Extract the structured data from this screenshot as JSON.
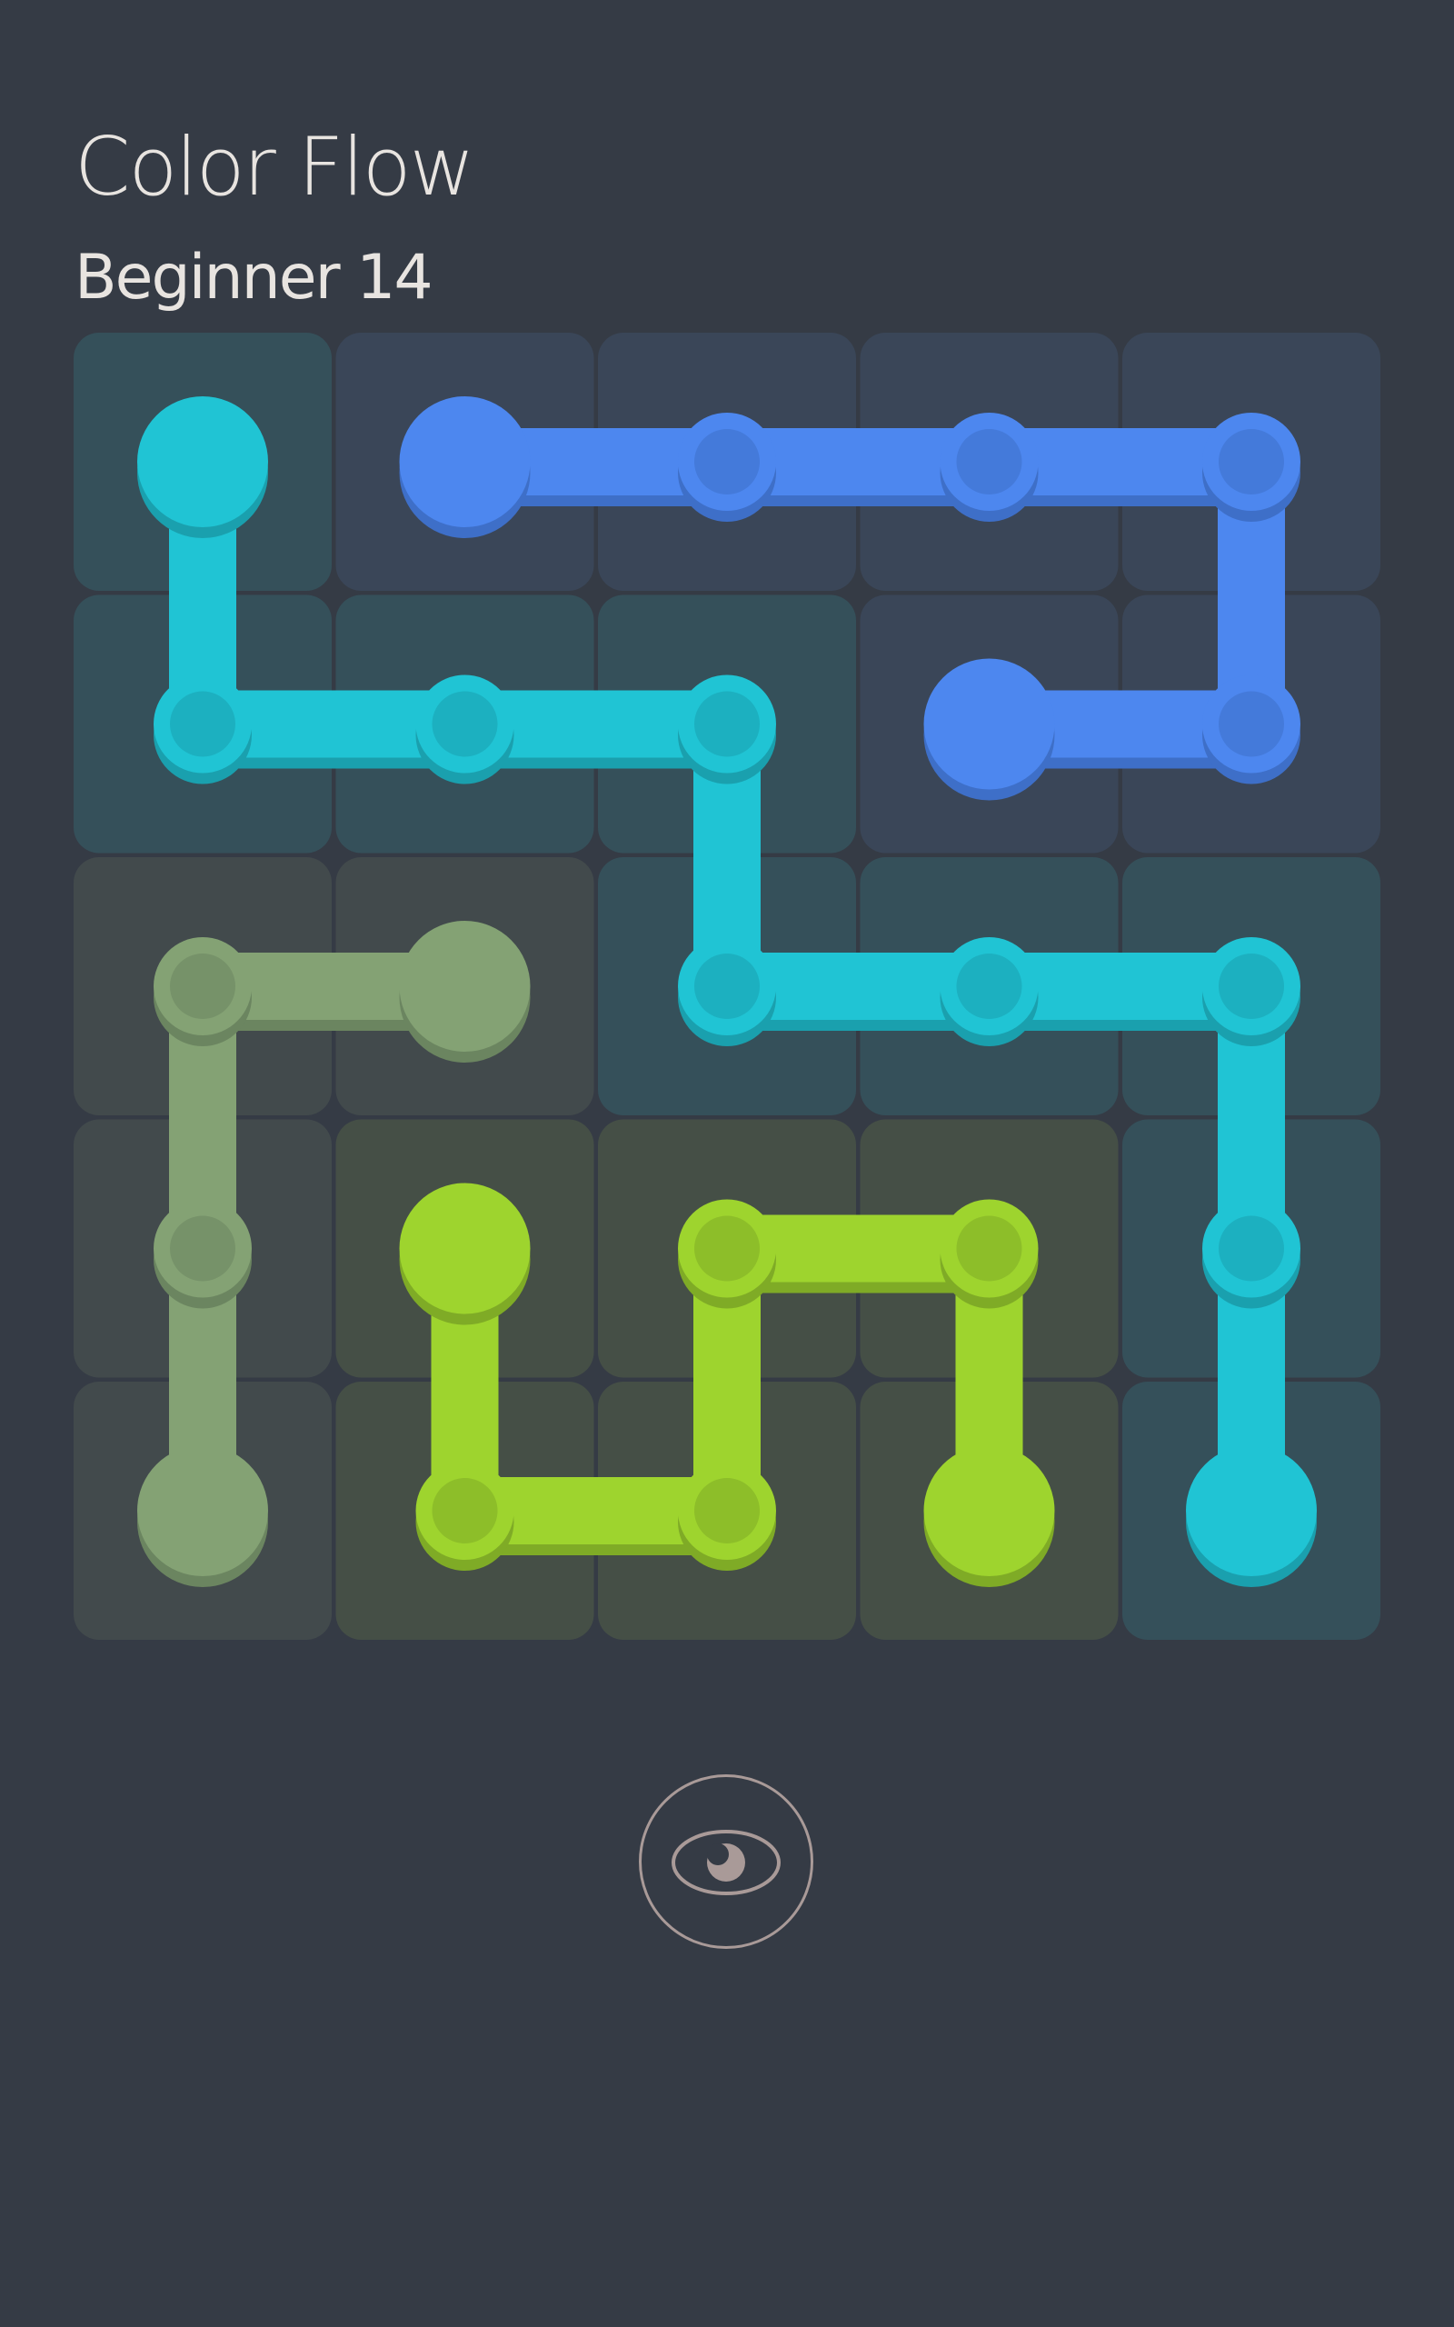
{
  "header": {
    "app_title": "Color Flow",
    "level_title": "Beginner 14"
  },
  "board": {
    "rows": 5,
    "cols": 5,
    "flows": [
      {
        "name": "cyan",
        "color": "#20c4d4",
        "shadow": "#1aa0ae",
        "tile": "#35505a",
        "path": [
          [
            0,
            0
          ],
          [
            1,
            0
          ],
          [
            1,
            1
          ],
          [
            1,
            2
          ],
          [
            2,
            2
          ],
          [
            2,
            3
          ],
          [
            2,
            4
          ],
          [
            3,
            4
          ],
          [
            4,
            4
          ]
        ]
      },
      {
        "name": "blue",
        "color": "#4d87ef",
        "shadow": "#3e6fc8",
        "tile": "#3a4658",
        "path": [
          [
            0,
            1
          ],
          [
            0,
            2
          ],
          [
            0,
            3
          ],
          [
            0,
            4
          ],
          [
            1,
            4
          ],
          [
            1,
            3
          ]
        ]
      },
      {
        "name": "sage",
        "color": "#84a274",
        "shadow": "#6b8560",
        "tile": "#424a4c",
        "path": [
          [
            2,
            1
          ],
          [
            2,
            0
          ],
          [
            3,
            0
          ],
          [
            4,
            0
          ]
        ]
      },
      {
        "name": "lime",
        "color": "#9ed42e",
        "shadow": "#7fab26",
        "tile": "#454f46",
        "path": [
          [
            3,
            1
          ],
          [
            4,
            1
          ],
          [
            4,
            2
          ],
          [
            3,
            2
          ],
          [
            3,
            3
          ],
          [
            4,
            3
          ]
        ]
      }
    ]
  },
  "controls": {
    "hint_icon": "eye-icon",
    "hint_color": "#a99a98"
  }
}
